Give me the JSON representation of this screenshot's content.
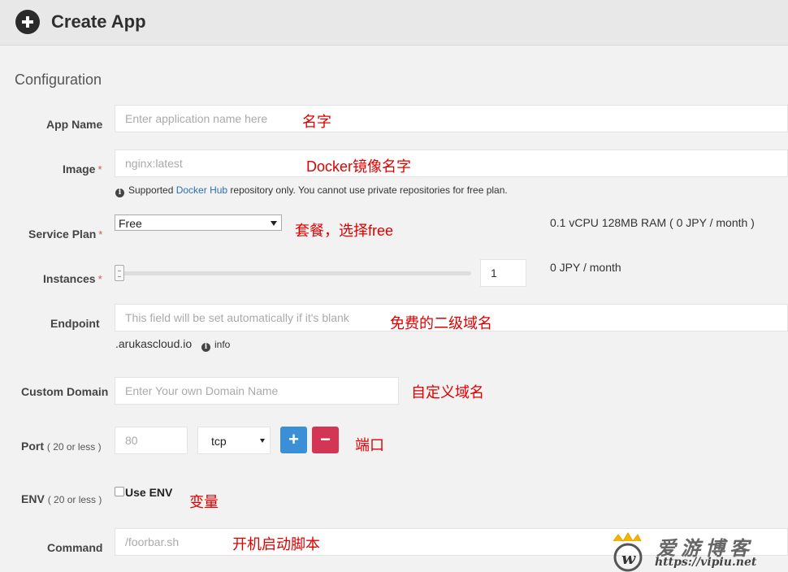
{
  "header": {
    "title": "Create App",
    "icon": "plus-circle-icon"
  },
  "section": {
    "title": "Configuration"
  },
  "fields": {
    "app_name": {
      "label": "App Name",
      "placeholder": "Enter application name here",
      "annotation": "名字"
    },
    "image": {
      "label": "Image",
      "required": "*",
      "placeholder": "nginx:latest",
      "annotation": "Docker镜像名字",
      "help_prefix": "Supported ",
      "help_link": "Docker Hub",
      "help_suffix": " repository only. You cannot use private repositories for free plan."
    },
    "service_plan": {
      "label": "Service Plan",
      "required": "*",
      "selected": "Free",
      "annotation": "套餐，选择free",
      "spec": "0.1 vCPU 128MB RAM ( 0 JPY / month )"
    },
    "instances": {
      "label": "Instances",
      "required": "*",
      "value": "1",
      "price": "0 JPY / month",
      "slider_level": 0
    },
    "endpoint": {
      "label": "Endpoint",
      "placeholder": "This field will be set automatically if it's blank",
      "annotation": "免费的二级域名",
      "suffix": ".arukascloud.io",
      "info": "info"
    },
    "custom_domain": {
      "label": "Custom Domain",
      "placeholder": "Enter Your own Domain Name",
      "annotation": "自定义域名"
    },
    "port": {
      "label": "Port",
      "hint": "( 20 or less )",
      "placeholder": "80",
      "protocol": "tcp",
      "add": "+",
      "remove": "−",
      "annotation": "端口"
    },
    "env": {
      "label": "ENV",
      "hint": "( 20 or less )",
      "checkbox_label": "Use ENV",
      "annotation": "变量"
    },
    "command": {
      "label": "Command",
      "placeholder": "/foorbar.sh",
      "annotation": "开机启动脚本"
    }
  },
  "watermark": {
    "text": "爱游博客",
    "url": "https://vipiu.net"
  },
  "colors": {
    "annotation": "#e00000",
    "add_button": "#3b8fd6",
    "remove_button": "#d23654",
    "link": "#2a6fb5"
  }
}
